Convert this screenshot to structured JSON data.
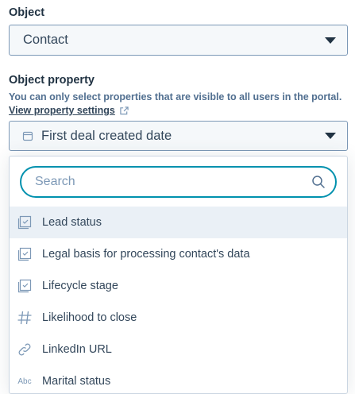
{
  "object": {
    "label": "Object",
    "value": "Contact"
  },
  "property": {
    "label": "Object property",
    "help": "You can only select properties that are visible to all users in the portal.",
    "link": "View property settings",
    "value": "First deal created date"
  },
  "search": {
    "placeholder": "Search"
  },
  "options": [
    {
      "label": "Lead status",
      "icon": "enumeration-icon",
      "highlighted": true
    },
    {
      "label": "Legal basis for processing contact's data",
      "icon": "enumeration-icon"
    },
    {
      "label": "Lifecycle stage",
      "icon": "enumeration-icon"
    },
    {
      "label": "Likelihood to close",
      "icon": "number-icon"
    },
    {
      "label": "LinkedIn URL",
      "icon": "link-icon"
    },
    {
      "label": "Marital status",
      "icon": "text-icon"
    }
  ]
}
